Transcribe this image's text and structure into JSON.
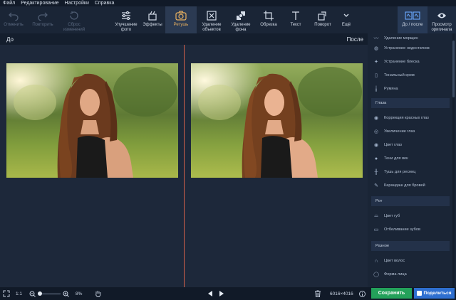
{
  "menu": [
    "Файл",
    "Редактирование",
    "Настройки",
    "Справка"
  ],
  "toolbar": {
    "undo": "Отменить",
    "redo": "Повторить",
    "reset": "Сброс изменений",
    "enhance": "Улучшение фото",
    "effects": "Эффекты",
    "retouch": "Ретушь",
    "remove_objects": "Удаление объектов",
    "remove_bg": "Удаление фона",
    "crop": "Обрезка",
    "text": "Текст",
    "rotate": "Поворот",
    "more": "Ещё",
    "before_after": "До / после",
    "view_original": "Просмотр оригинала"
  },
  "viewer": {
    "before_label": "До",
    "after_label": "После"
  },
  "sidebar": {
    "items_top": [
      {
        "label": "Удаление морщин",
        "icon": "wrinkle-icon"
      },
      {
        "label": "Устранение недостатков",
        "icon": "blemish-icon"
      },
      {
        "label": "Устранение блеска",
        "icon": "shine-icon"
      },
      {
        "label": "Тональный крем",
        "icon": "foundation-icon"
      },
      {
        "label": "Румяна",
        "icon": "blush-icon"
      }
    ],
    "section_eyes": "Глаза",
    "items_eyes": [
      {
        "label": "Коррекция красных глаз",
        "icon": "redeye-icon"
      },
      {
        "label": "Увеличение глаз",
        "icon": "eye-enlarge-icon"
      },
      {
        "label": "Цвет глаз",
        "icon": "eye-color-icon"
      },
      {
        "label": "Тени для век",
        "icon": "eyeshadow-icon"
      },
      {
        "label": "Тушь для ресниц",
        "icon": "mascara-icon"
      },
      {
        "label": "Карандаш для бровей",
        "icon": "brow-pencil-icon"
      }
    ],
    "section_mouth": "Рот",
    "items_mouth": [
      {
        "label": "Цвет губ",
        "icon": "lips-icon"
      },
      {
        "label": "Отбеливание зубов",
        "icon": "teeth-icon"
      }
    ],
    "section_misc": "Разное",
    "items_misc": [
      {
        "label": "Цвет волос",
        "icon": "hair-icon"
      },
      {
        "label": "Форма лица",
        "icon": "face-shape-icon"
      }
    ]
  },
  "status": {
    "ratio": "1:1",
    "zoom": "8%",
    "dimensions": "6016×4016",
    "save": "Сохранить",
    "share": "Поделиться"
  },
  "colors": {
    "accent": "#e8b060",
    "divider": "#d2614a",
    "save": "#23a15a",
    "share": "#2e6fd0"
  }
}
